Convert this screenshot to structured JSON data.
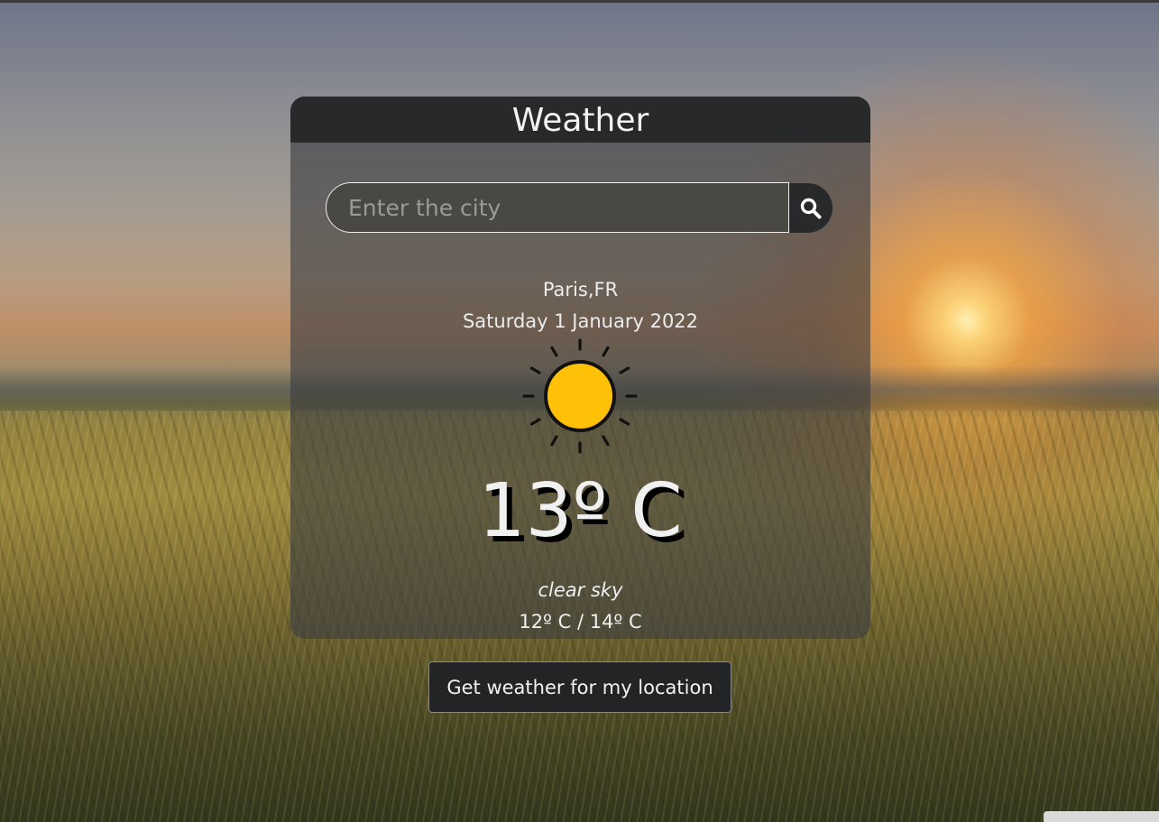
{
  "app": {
    "title": "Weather"
  },
  "search": {
    "placeholder": "Enter the city",
    "value": "",
    "icon": "search-icon"
  },
  "weather": {
    "location": "Paris,FR",
    "date": "Saturday 1 January 2022",
    "icon": "sun-icon",
    "temperature": "13º C",
    "description": "clear sky",
    "min_max": "12º C / 14º C"
  },
  "actions": {
    "location_button_label": "Get weather for my location"
  },
  "colors": {
    "card_header": "#27292b",
    "sun_fill": "#FFC107",
    "text": "#F0F0F0"
  }
}
